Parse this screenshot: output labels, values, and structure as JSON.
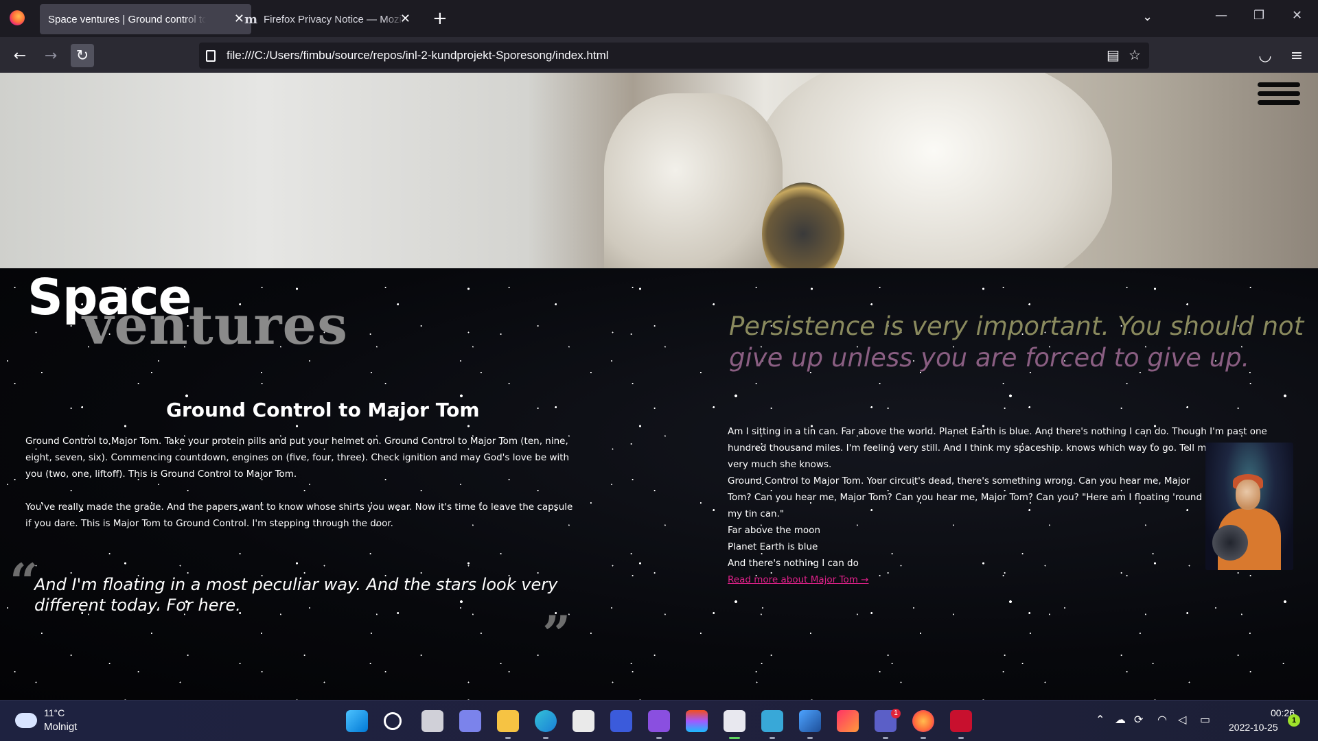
{
  "browser": {
    "tabs": [
      {
        "title": "Space ventures | Ground control to Major Tom"
      },
      {
        "title": "Firefox Privacy Notice — Mozilla"
      }
    ],
    "url": "file:///C:/Users/fimbu/source/repos/inl-2-kundprojekt-Sporesong/index.html"
  },
  "site": {
    "logo_word1": "Space",
    "logo_word2": "ventures",
    "left": {
      "heading": "Ground Control to Major Tom",
      "paragraph1": "Ground Control to Major Tom. Take your protein pills and put your helmet on. Ground Control to Major Tom (ten, nine, eight, seven, six). Commencing countdown, engines on (five, four, three). Check ignition and may God's love be with you (two, one, liftoff). This is Ground Control to Major Tom.",
      "paragraph2": "You've really made the grade. And the papers want to know whose shirts you wear. Now it's time to leave the capsule if you dare. This is Major Tom to Ground Control. I'm stepping through the door.",
      "quote": "And I'm floating in a most peculiar way. And the stars look very different today. For here.",
      "quote_open": "“",
      "quote_close": "”"
    },
    "right": {
      "quote": "Persistence is very important. You should not give up unless you are forced to give up.",
      "lines": [
        "Am I sitting in a tin can. Far above the world. Planet Earth is blue. And there's nothing I can do. Though I'm past one hundred thousand miles. I'm feeling very still. And I think my spaceship. knows which way to go. Tell my wife I love her very much she knows.",
        "Ground Control to Major Tom. Your circuit's dead, there's something wrong. Can you hear me, Major Tom? Can you hear me, Major Tom? Can you hear me, Major Tom? Can you? \"Here am I floating 'round my tin can.\"",
        "Far above the moon",
        "Planet Earth is blue",
        "And there's nothing I can do"
      ],
      "read_more": "Read more about Major Tom →"
    }
  },
  "taskbar": {
    "weather_temp": "11°C",
    "weather_desc": "Molnigt",
    "time": "00:26",
    "date": "2022-10-25",
    "notification_count": "1",
    "teams_badge": "1",
    "icons": [
      "windows-start",
      "search",
      "task-view",
      "teams-chat",
      "file-explorer",
      "edge",
      "microsoft-store",
      "visual-studio-code-insiders",
      "visual-studio",
      "figma",
      "snipping-tool",
      "notepad",
      "photos",
      "creative-cloud",
      "teams",
      "firefox",
      "mcafee"
    ]
  }
}
